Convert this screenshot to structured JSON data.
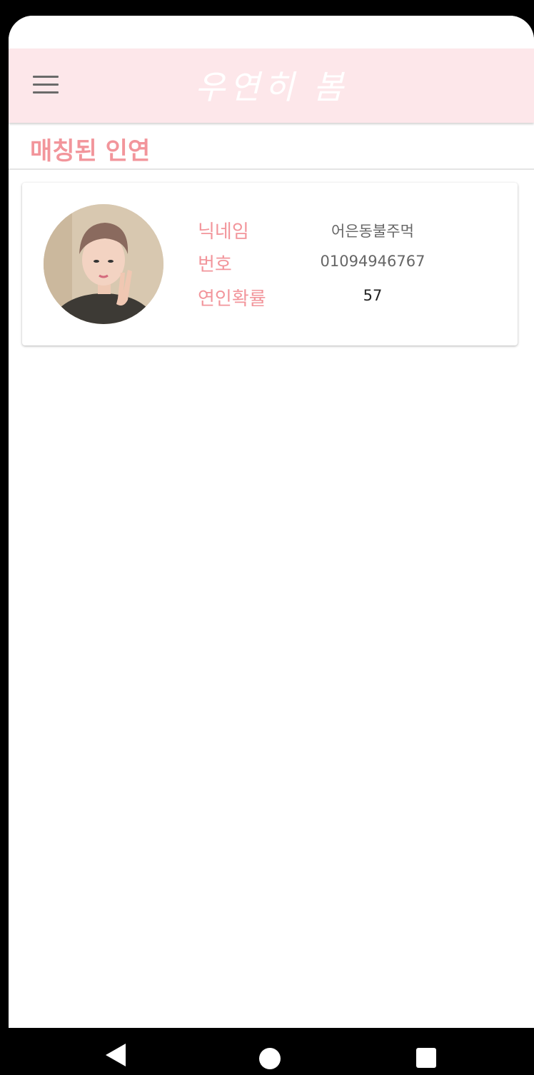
{
  "app": {
    "title": "우연히 봄"
  },
  "page": {
    "section_title": "매칭된 인연"
  },
  "match": {
    "nickname_label": "닉네임",
    "nickname": "어은동불주먹",
    "phone_label": "번호",
    "phone": "01094946767",
    "probability_label": "연인확률",
    "probability": "57"
  },
  "colors": {
    "appbar": "#fde7ea",
    "accent": "#f2959b"
  },
  "icons": {
    "menu": "hamburger-icon",
    "back": "back-triangle-icon",
    "home": "home-circle-icon",
    "recent": "recent-square-icon"
  }
}
